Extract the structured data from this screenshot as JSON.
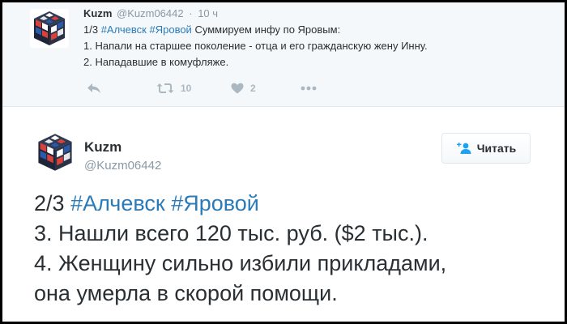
{
  "tweet1": {
    "author_name": "Kuzm",
    "author_handle": "@Kuzm06442",
    "separator": "·",
    "time": "10 ч",
    "text_prefix": "1/3",
    "hashtags": [
      "#Алчевск",
      "#Яровой"
    ],
    "text_rest": "Суммируем инфу по Яровым:",
    "lines": [
      "1. Напали на старшее поколение - отца и его гражданскую жену Инну.",
      "2. Нападавшие в комуфляже."
    ],
    "actions": {
      "reply_icon": "reply-icon",
      "retweet_icon": "retweet-icon",
      "retweet_count": "10",
      "like_icon": "heart-icon",
      "like_count": "2",
      "more_icon": "more-icon"
    }
  },
  "tweet2": {
    "author_name": "Kuzm",
    "author_handle": "@Kuzm06442",
    "follow_label": "Читать",
    "follow_icon": "follow-user-icon",
    "text_prefix": "2/3",
    "hashtags": [
      "#Алчевск",
      "#Яровой"
    ],
    "lines": [
      "3. Нашли всего 120 тыс. руб. ($2 тыс.).",
      "4. Женщину сильно избили прикладами,",
      "она умерла в скорой помощи."
    ]
  },
  "colors": {
    "link": "#2b7bb9",
    "muted": "#8899a6",
    "text": "#292f33",
    "action_icon": "#aab8c2",
    "timeline_bg": "#f5f8fa"
  }
}
